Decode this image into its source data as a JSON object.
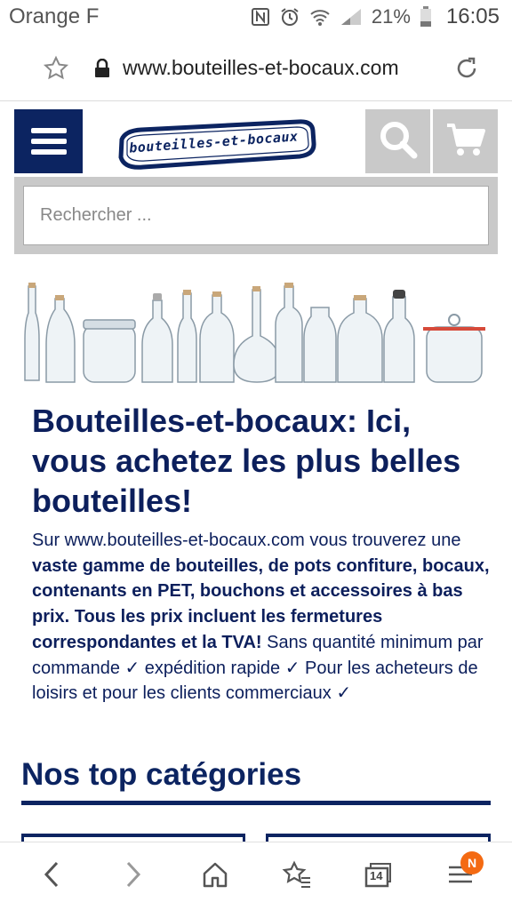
{
  "status_bar": {
    "carrier": "Orange F",
    "battery": "21%",
    "time": "16:05"
  },
  "browser": {
    "url": "www.bouteilles-et-bocaux.com"
  },
  "site": {
    "logo_text": "bouteilles-et-bocaux",
    "search_placeholder": "Rechercher ..."
  },
  "content": {
    "headline": "Bouteilles-et-bocaux: Ici, vous achetez les plus belles bouteilles!",
    "intro_1": "Sur www.bouteilles-et-bocaux.com vous trouverez une ",
    "intro_bold": "vaste gamme de bouteilles, de pots confiture, bocaux, contenants en PET, bouchons et accessoires à bas prix. Tous les prix incluent les fermetures correspondantes et la TVA!",
    "intro_2": " Sans quantité minimum par commande ✓ expédition rapide ✓ Pour les acheteurs de loisirs et pour les clients commerciaux ✓",
    "categories_title": "Nos top catégories"
  },
  "bottom_nav": {
    "tab_count": "14",
    "badge": "N"
  },
  "colors": {
    "brand_navy": "#0c2461",
    "badge_orange": "#f46a12",
    "header_gray": "#c9c9c9"
  }
}
